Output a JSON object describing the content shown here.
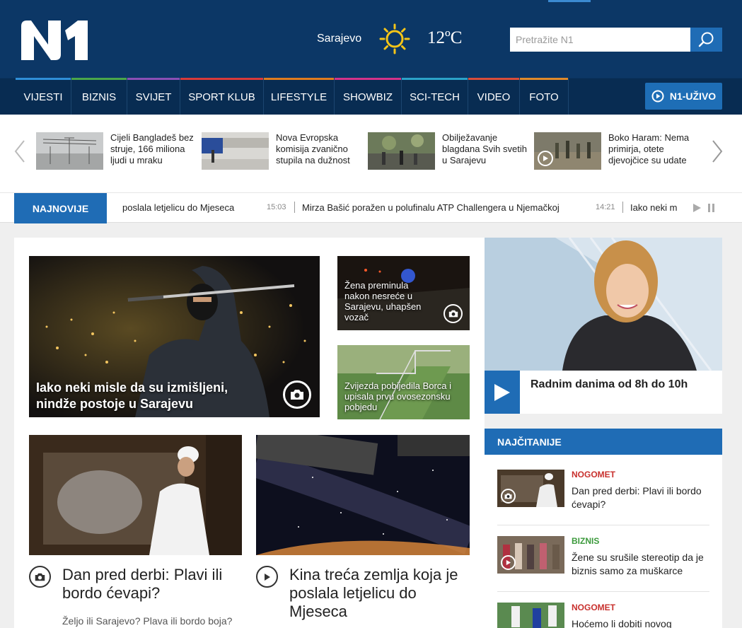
{
  "header": {
    "city": "Sarajevo",
    "temperature": "12ºC",
    "search_placeholder": "Pretražite N1"
  },
  "nav": {
    "items": [
      {
        "label": "VIJESTI",
        "color": "#2f8fd8"
      },
      {
        "label": "BIZNIS",
        "color": "#4aa64a"
      },
      {
        "label": "SVIJET",
        "color": "#8b4fb5"
      },
      {
        "label": "SPORT KLUB",
        "color": "#d93a3a"
      },
      {
        "label": "LIFESTYLE",
        "color": "#e07c1f"
      },
      {
        "label": "SHOWBIZ",
        "color": "#d3338a"
      },
      {
        "label": "SCI-TECH",
        "color": "#2ba3c9"
      },
      {
        "label": "VIDEO",
        "color": "#d94d3a"
      },
      {
        "label": "FOTO",
        "color": "#e08a2b"
      }
    ],
    "live_label": "N1-UŽIVO"
  },
  "strip": {
    "items": [
      {
        "text": "Cijeli Bangladeš bez struje, 166 miliona ljudi u mraku"
      },
      {
        "text": "Nova Evropska komisija zvanično stupila na dužnost"
      },
      {
        "text": "Obilježavanje blagdana Svih svetih u Sarajevu"
      },
      {
        "text": "Boko Haram: Nema primirja, otete djevojčice su udate"
      }
    ]
  },
  "ticker": {
    "label": "NAJNOVIJE",
    "items": [
      {
        "time": "",
        "text": "poslala letjelicu do Mjeseca"
      },
      {
        "time": "15:03",
        "text": "Mirza Bašić poražen u polufinalu ATP Challengera u Njemačkoj"
      },
      {
        "time": "14:21",
        "text": "Iako neki m"
      }
    ]
  },
  "main": {
    "lead_title": "Iako neki misle da su izmišljeni, nindže postoje u Sarajevu",
    "side_top": "Žena preminula nakon nesreće u Sarajevu, uhapšen vozač",
    "side_bottom": "Zvijezda pobijedila Borca i upisala prvu ovosezonsku pobjedu",
    "bottom_left_title": "Dan pred derbi: Plavi ili bordo ćevapi?",
    "bottom_left_excerpt": "Željo ili Sarajevo? Plava ili bordo boja?",
    "bottom_right_title": "Kina treća zemlja koja je poslala letjelicu do Mjeseca"
  },
  "promo": {
    "text": "Radnim danima od 8h do 10h"
  },
  "najcitanije": {
    "title": "NAJČITANIJE",
    "items": [
      {
        "category": "NOGOMET",
        "color": "#c8312e",
        "title": "Dan pred derbi: Plavi ili bordo ćevapi?"
      },
      {
        "category": "BIZNIS",
        "color": "#3c9a3c",
        "title": "Žene su srušile stereotip da je biznis samo za muškarce"
      },
      {
        "category": "NOGOMET",
        "color": "#c8312e",
        "title": "Hoćemo li dobiti novog"
      }
    ]
  }
}
